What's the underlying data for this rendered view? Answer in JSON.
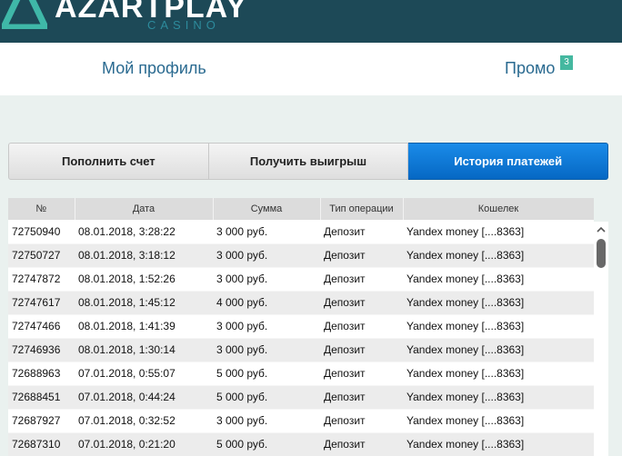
{
  "header": {
    "logo_text": "AZARTPLAY",
    "logo_sub": "CASINO"
  },
  "nav": {
    "profile_label": "Мой профиль",
    "promo_label": "Промо",
    "promo_badge": "3"
  },
  "tabs": [
    {
      "label": "Пополнить счет",
      "active": false
    },
    {
      "label": "Получить выигрыш",
      "active": false
    },
    {
      "label": "История платежей",
      "active": true
    }
  ],
  "table": {
    "columns": [
      "№",
      "Дата",
      "Сумма",
      "Тип операции",
      "Кошелек"
    ],
    "rows": [
      {
        "id": "72750940",
        "date": "08.01.2018, 3:28:22",
        "amount": "3 000 руб.",
        "type": "Депозит",
        "wallet": "Yandex money [....8363]"
      },
      {
        "id": "72750727",
        "date": "08.01.2018, 3:18:12",
        "amount": "3 000 руб.",
        "type": "Депозит",
        "wallet": "Yandex money [....8363]"
      },
      {
        "id": "72747872",
        "date": "08.01.2018, 1:52:26",
        "amount": "3 000 руб.",
        "type": "Депозит",
        "wallet": "Yandex money [....8363]"
      },
      {
        "id": "72747617",
        "date": "08.01.2018, 1:45:12",
        "amount": "4 000 руб.",
        "type": "Депозит",
        "wallet": "Yandex money [....8363]"
      },
      {
        "id": "72747466",
        "date": "08.01.2018, 1:41:39",
        "amount": "3 000 руб.",
        "type": "Депозит",
        "wallet": "Yandex money [....8363]"
      },
      {
        "id": "72746936",
        "date": "08.01.2018, 1:30:14",
        "amount": "3 000 руб.",
        "type": "Депозит",
        "wallet": "Yandex money [....8363]"
      },
      {
        "id": "72688963",
        "date": "07.01.2018, 0:55:07",
        "amount": "5 000 руб.",
        "type": "Депозит",
        "wallet": "Yandex money [....8363]"
      },
      {
        "id": "72688451",
        "date": "07.01.2018, 0:44:24",
        "amount": "5 000 руб.",
        "type": "Депозит",
        "wallet": "Yandex money [....8363]"
      },
      {
        "id": "72687927",
        "date": "07.01.2018, 0:32:52",
        "amount": "3 000 руб.",
        "type": "Депозит",
        "wallet": "Yandex money [....8363]"
      },
      {
        "id": "72687310",
        "date": "07.01.2018, 0:21:20",
        "amount": "5 000 руб.",
        "type": "Депозит",
        "wallet": "Yandex money [....8363]"
      }
    ]
  },
  "scrollbar": {
    "up_icon": "chevron-up-icon"
  },
  "colors": {
    "header_bg": "#1d4957",
    "active_tab": "#0a78d8",
    "link": "#2a6a90",
    "badge": "#45b8a0"
  }
}
